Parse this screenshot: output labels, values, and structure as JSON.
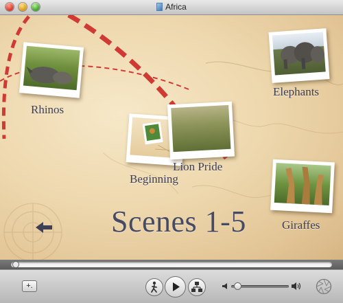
{
  "window": {
    "title": "Africa",
    "icon": "document-icon"
  },
  "chapters": [
    {
      "label": "Rhinos"
    },
    {
      "label": "Elephants"
    },
    {
      "label": "Beginning"
    },
    {
      "label": "Lion Pride"
    },
    {
      "label": "Giraffes"
    }
  ],
  "main_title": "Scenes 1-5",
  "controls": {
    "add_label": "+.",
    "buttons": [
      "walk-menu-icon",
      "play-icon",
      "chapters-icon"
    ],
    "volume_level": 0.05,
    "playback_progress": 0.0
  },
  "colors": {
    "route_red": "#d03a34",
    "label_ink": "#3b3e55",
    "map_paper": "#eed8ae"
  }
}
